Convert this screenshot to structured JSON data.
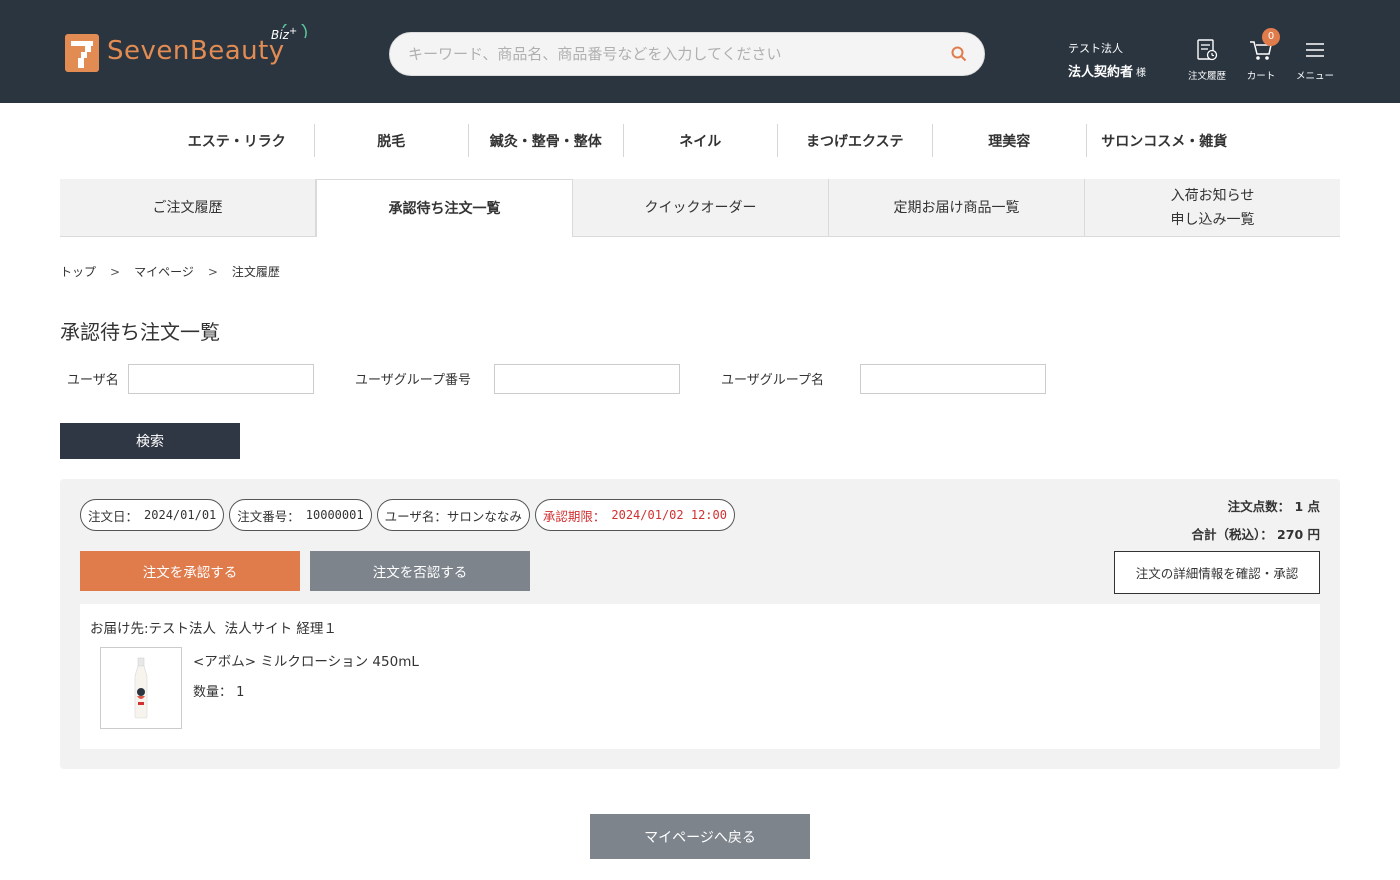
{
  "header": {
    "logo_text": "SevenBeauty",
    "logo_badge": "Biz",
    "search_placeholder": "キーワード、商品名、商品番号などを入力してください",
    "user_company": "テスト法人",
    "user_name": "法人契約者",
    "user_suffix": "様",
    "order_history_label": "注文履歴",
    "cart_label": "カート",
    "cart_count": "0",
    "menu_label": "メニュー",
    "brand_color": "#e07b4c"
  },
  "categories": [
    "エステ・リラク",
    "脱毛",
    "鍼灸・整骨・整体",
    "ネイル",
    "まつげエクステ",
    "理美容",
    "サロンコスメ・雑貨"
  ],
  "tabs": [
    {
      "label": "ご注文履歴",
      "active": false
    },
    {
      "label": "承認待ち注文一覧",
      "active": true
    },
    {
      "label": "クイックオーダー",
      "active": false
    },
    {
      "label": "定期お届け商品一覧",
      "active": false
    },
    {
      "label": "入荷お知らせ\n申し込み一覧",
      "active": false
    }
  ],
  "breadcrumb": [
    "トップ",
    "マイページ",
    "注文履歴"
  ],
  "page_title": "承認待ち注文一覧",
  "filters": {
    "user_name_label": "ユーザ名",
    "user_name_value": "",
    "group_no_label": "ユーザグループ番号",
    "group_no_value": "",
    "group_name_label": "ユーザグループ名",
    "group_name_value": "",
    "search_button": "検索"
  },
  "order": {
    "date_label": "注文日：",
    "date_value": "2024/01/01",
    "number_label": "注文番号：",
    "number_value": "10000001",
    "user_label": "ユーザ名：",
    "user_value": "サロンななみ",
    "deadline_label": "承認期限：",
    "deadline_value": "2024/01/02 12:00",
    "item_count": "注文点数： 1 点",
    "total": "合計（税込）： 270 円",
    "approve_button": "注文を承認する",
    "reject_button": "注文を否認する",
    "detail_button": "注文の詳細情報を確認・承認",
    "delivery_address": "お届け先:テスト法人  法人サイト 経理１",
    "product_name": "<アボム> ミルクローション 450mL",
    "quantity": "数量： 1"
  },
  "back_button": "マイページへ戻る"
}
